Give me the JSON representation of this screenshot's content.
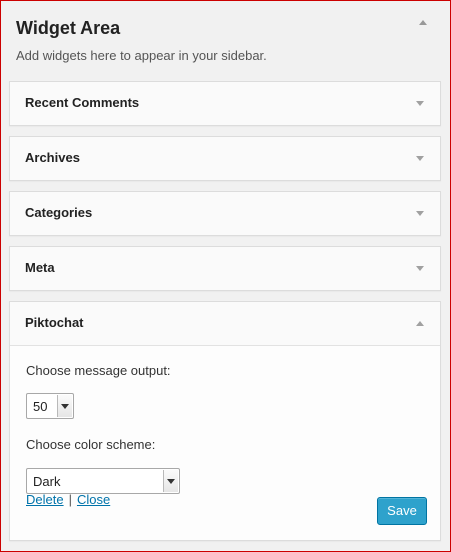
{
  "sidebar": {
    "title": "Widget Area",
    "description": "Add widgets here to appear in your sidebar."
  },
  "widgets": [
    {
      "title": "Recent Comments"
    },
    {
      "title": "Archives"
    },
    {
      "title": "Categories"
    },
    {
      "title": "Meta"
    }
  ],
  "open_widget": {
    "title": "Piktochat",
    "message_output_label": "Choose message output:",
    "message_output_value": "50",
    "color_scheme_label": "Choose color scheme:",
    "color_scheme_value": "Dark",
    "delete_label": "Delete",
    "separator": "|",
    "close_label": "Close",
    "save_label": "Save"
  },
  "colors": {
    "accent": "#2ea2cc",
    "link": "#0073aa",
    "panel_border": "#cc0000"
  }
}
